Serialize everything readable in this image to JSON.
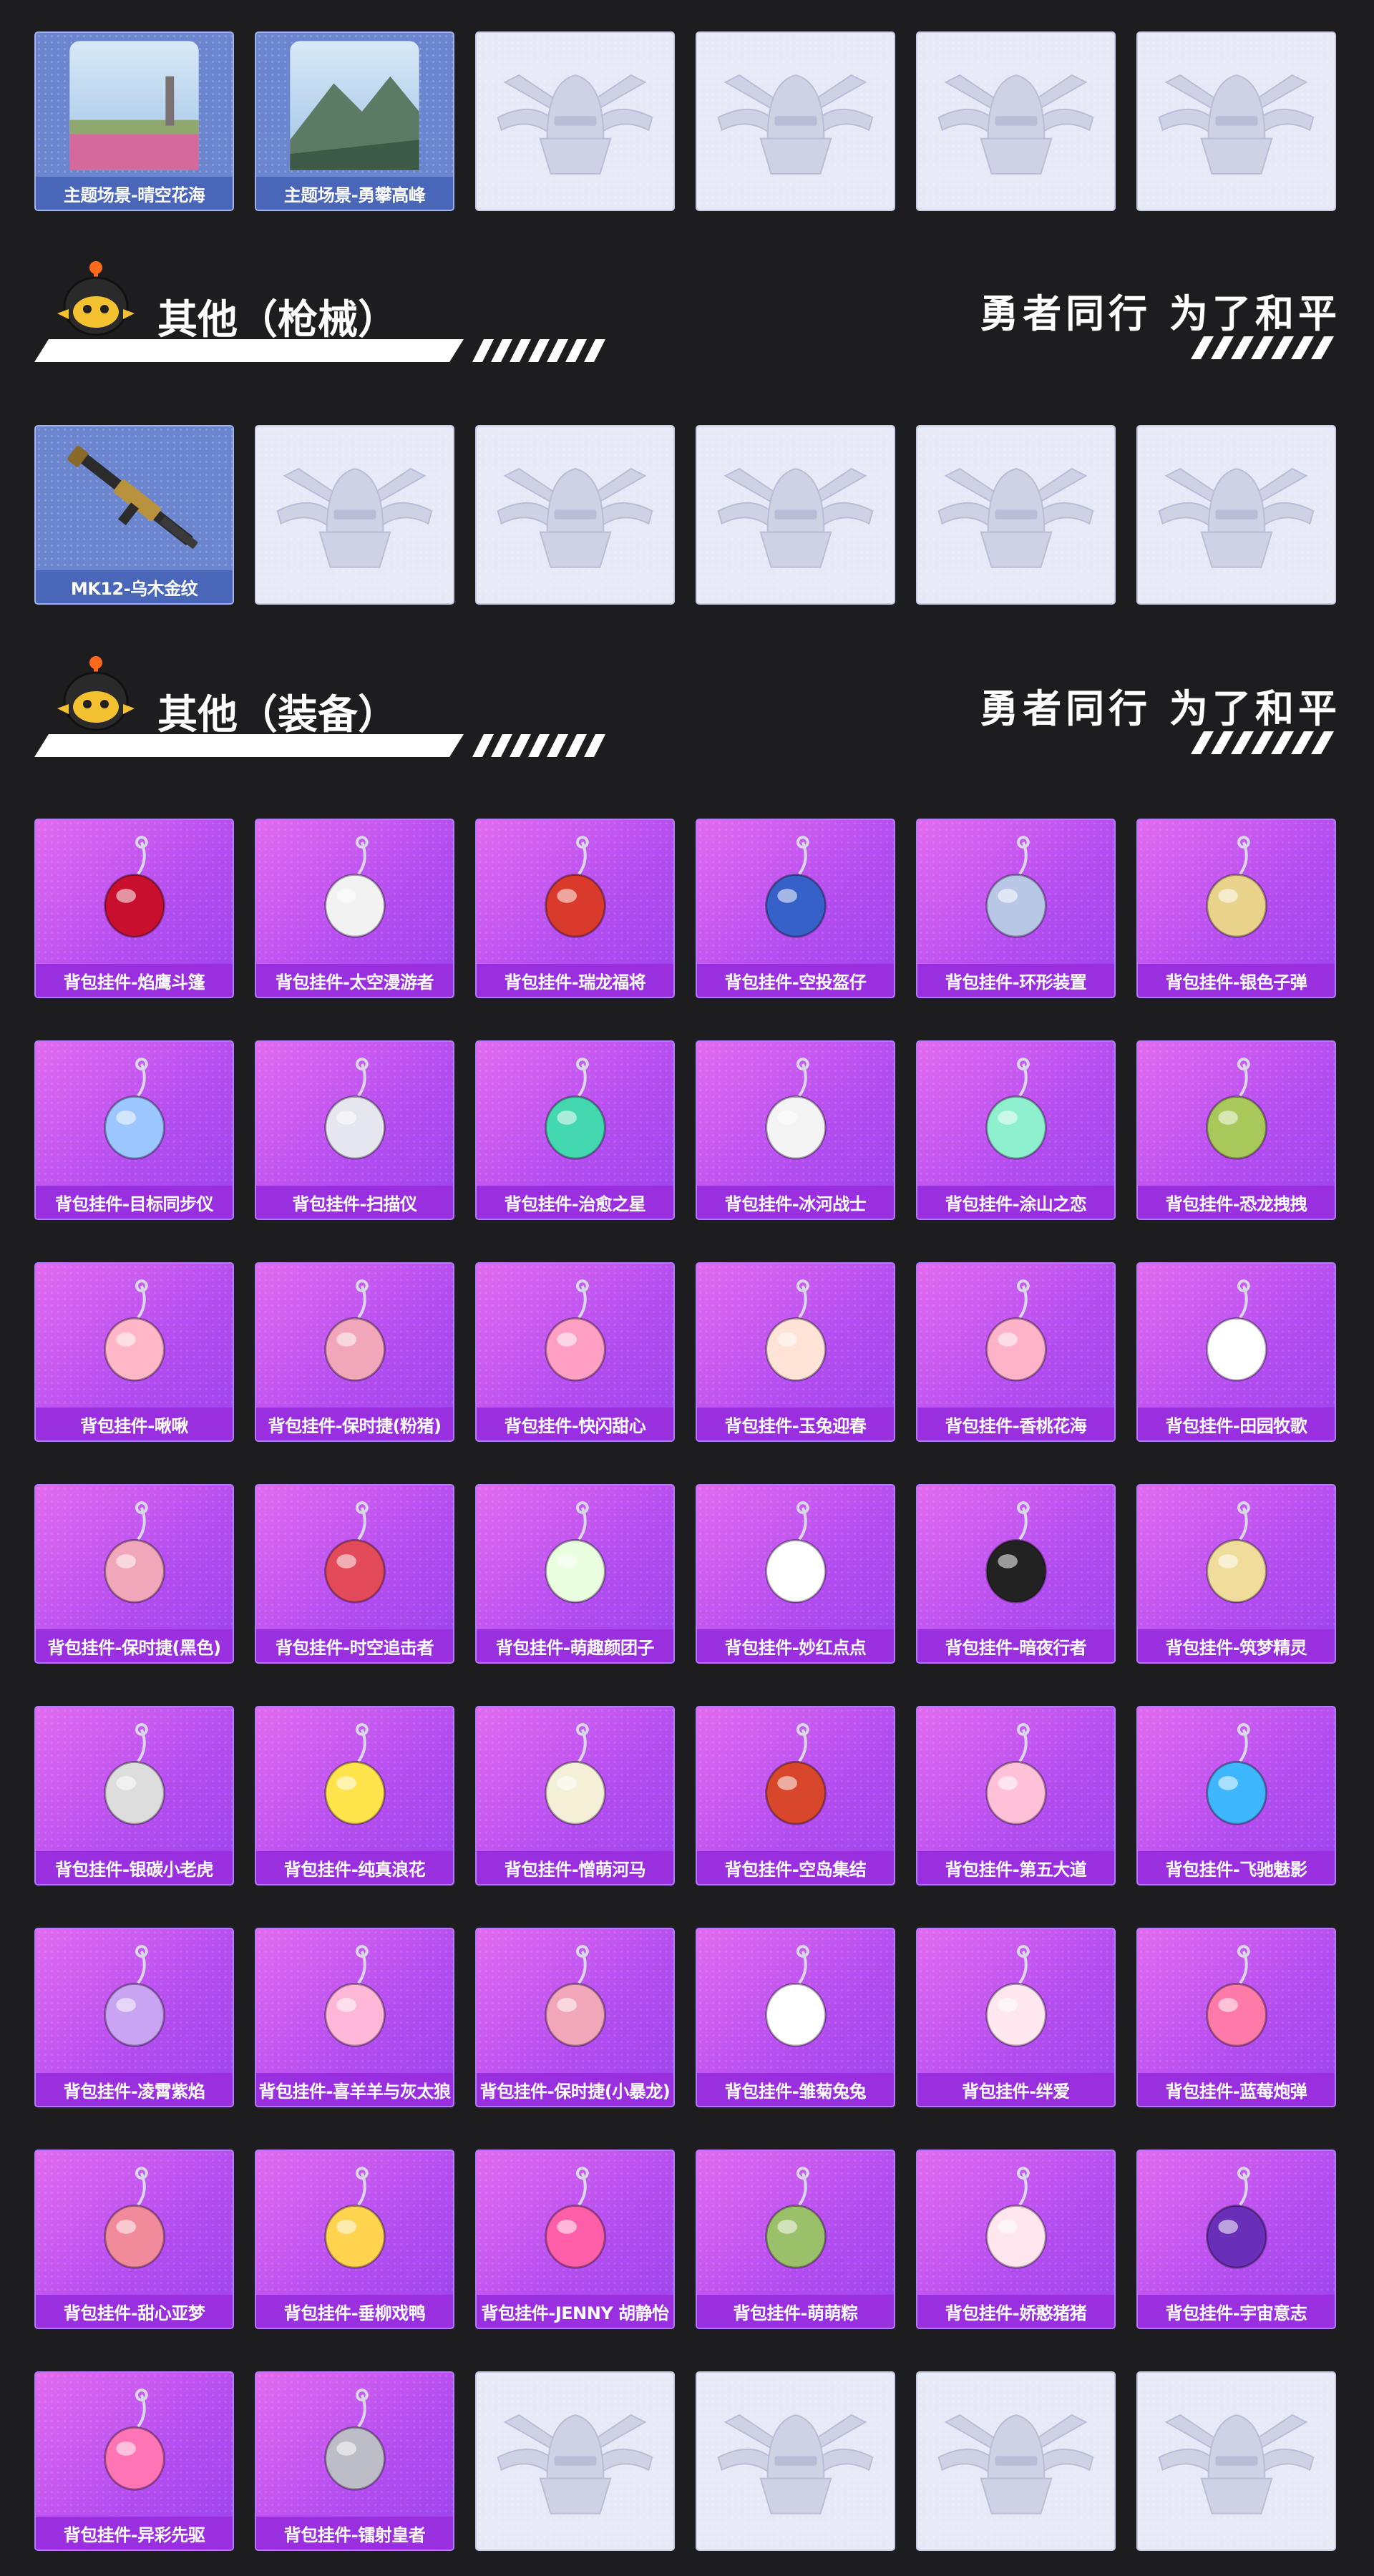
{
  "top_row": {
    "items": [
      {
        "label": "主题场景-晴空花海",
        "kind": "scene",
        "icon": "flower-field-scene"
      },
      {
        "label": "主题场景-勇攀高峰",
        "kind": "scene",
        "icon": "mountain-scene"
      },
      {
        "label": "",
        "kind": "empty",
        "icon": "helmet-emblem-icon"
      },
      {
        "label": "",
        "kind": "empty",
        "icon": "helmet-emblem-icon"
      },
      {
        "label": "",
        "kind": "empty",
        "icon": "helmet-emblem-icon"
      },
      {
        "label": "",
        "kind": "empty",
        "icon": "helmet-emblem-icon"
      }
    ]
  },
  "sections": [
    {
      "title": "其他（枪械）",
      "slogan": "勇者同行 为了和平",
      "rows": [
        [
          {
            "label": "MK12-乌木金纹",
            "kind": "gun",
            "icon": "rifle-icon"
          },
          {
            "label": "",
            "kind": "empty",
            "icon": "helmet-emblem-icon"
          },
          {
            "label": "",
            "kind": "empty",
            "icon": "helmet-emblem-icon"
          },
          {
            "label": "",
            "kind": "empty",
            "icon": "helmet-emblem-icon"
          },
          {
            "label": "",
            "kind": "empty",
            "icon": "helmet-emblem-icon"
          },
          {
            "label": "",
            "kind": "empty",
            "icon": "helmet-emblem-icon"
          }
        ]
      ]
    },
    {
      "title": "其他（装备）",
      "slogan": "勇者同行 为了和平",
      "rows": [
        [
          {
            "label": "背包挂件-焰鹰斗篷",
            "kind": "pendant",
            "icon": "knot-charm-icon"
          },
          {
            "label": "背包挂件-太空漫游者",
            "kind": "pendant",
            "icon": "astronaut-charm-icon"
          },
          {
            "label": "背包挂件-瑞龙福将",
            "kind": "pendant",
            "icon": "dragon-charm-icon"
          },
          {
            "label": "背包挂件-空投盔仔",
            "kind": "pendant",
            "icon": "helmet-charm-icon"
          },
          {
            "label": "背包挂件-环形装置",
            "kind": "pendant",
            "icon": "ring-charm-icon"
          },
          {
            "label": "背包挂件-银色子弹",
            "kind": "pendant",
            "icon": "bullet-charm-icon"
          }
        ],
        [
          {
            "label": "背包挂件-目标同步仪",
            "kind": "pendant",
            "icon": "loop-charm-icon"
          },
          {
            "label": "背包挂件-扫描仪",
            "kind": "pendant",
            "icon": "ghost-charm-icon"
          },
          {
            "label": "背包挂件-治愈之星",
            "kind": "pendant",
            "icon": "canister-charm-icon"
          },
          {
            "label": "背包挂件-冰河战士",
            "kind": "pendant",
            "icon": "robot-charm-icon"
          },
          {
            "label": "背包挂件-涂山之恋",
            "kind": "pendant",
            "icon": "fox-charm-icon"
          },
          {
            "label": "背包挂件-恐龙拽拽",
            "kind": "pendant",
            "icon": "dino-egg-charm-icon"
          }
        ],
        [
          {
            "label": "背包挂件-啾啾",
            "kind": "pendant",
            "icon": "chick-charm-icon"
          },
          {
            "label": "背包挂件-保时捷(粉猪)",
            "kind": "pendant",
            "icon": "car-key-charm-icon"
          },
          {
            "label": "背包挂件-快闪甜心",
            "kind": "pendant",
            "icon": "donut-charm-icon"
          },
          {
            "label": "背包挂件-玉兔迎春",
            "kind": "pendant",
            "icon": "rabbit-charm-icon"
          },
          {
            "label": "背包挂件-香桃花海",
            "kind": "pendant",
            "icon": "peach-blossom-charm-icon"
          },
          {
            "label": "背包挂件-田园牧歌",
            "kind": "pendant",
            "icon": "tag-charm-icon"
          }
        ],
        [
          {
            "label": "背包挂件-保时捷(黑色)",
            "kind": "pendant",
            "icon": "car-key-charm-icon"
          },
          {
            "label": "背包挂件-时空追击者",
            "kind": "pendant",
            "icon": "crest-charm-icon"
          },
          {
            "label": "背包挂件-萌趣颜团子",
            "kind": "pendant",
            "icon": "dumpling-charm-icon"
          },
          {
            "label": "背包挂件-妙红点点",
            "kind": "pendant",
            "icon": "daisy-charm-icon"
          },
          {
            "label": "背包挂件-暗夜行者",
            "kind": "pendant",
            "icon": "bird-charm-icon"
          },
          {
            "label": "背包挂件-筑梦精灵",
            "kind": "pendant",
            "icon": "butterfly-charm-icon"
          }
        ],
        [
          {
            "label": "背包挂件-银碳小老虎",
            "kind": "pendant",
            "icon": "tiger-charm-icon"
          },
          {
            "label": "背包挂件-纯真浪花",
            "kind": "pendant",
            "icon": "opener-charm-icon"
          },
          {
            "label": "背包挂件-憎萌河马",
            "kind": "pendant",
            "icon": "feather-charm-icon"
          },
          {
            "label": "背包挂件-空岛集结",
            "kind": "pendant",
            "icon": "pistol-charm-icon"
          },
          {
            "label": "背包挂件-第五大道",
            "kind": "pendant",
            "icon": "heart-charm-icon"
          },
          {
            "label": "背包挂件-飞驰魅影",
            "kind": "pendant",
            "icon": "winged-eye-charm-icon"
          }
        ],
        [
          {
            "label": "背包挂件-凌霄紫焰",
            "kind": "pendant",
            "icon": "flame-charm-icon"
          },
          {
            "label": "背包挂件-喜羊羊与灰太狼",
            "kind": "pendant",
            "icon": "bow-charm-icon"
          },
          {
            "label": "背包挂件-保时捷(小暴龙)",
            "kind": "pendant",
            "icon": "car-key-charm-icon"
          },
          {
            "label": "背包挂件-雏菊兔兔",
            "kind": "pendant",
            "icon": "bunny-charm-icon"
          },
          {
            "label": "背包挂件-绊爱",
            "kind": "pendant",
            "icon": "ribbon-tag-charm-icon"
          },
          {
            "label": "背包挂件-蓝莓炮弹",
            "kind": "pendant",
            "icon": "icecream-charm-icon"
          }
        ],
        [
          {
            "label": "背包挂件-甜心亚梦",
            "kind": "pendant",
            "icon": "paw-charm-icon"
          },
          {
            "label": "背包挂件-垂柳戏鸭",
            "kind": "pendant",
            "icon": "duck-charm-icon"
          },
          {
            "label": "背包挂件-JENNY 胡静怡",
            "kind": "pendant",
            "icon": "wings-charm-icon"
          },
          {
            "label": "背包挂件-萌萌粽",
            "kind": "pendant",
            "icon": "zongzi-charm-icon"
          },
          {
            "label": "背包挂件-娇憨猪猪",
            "kind": "pendant",
            "icon": "pig-charm-icon"
          },
          {
            "label": "背包挂件-宇宙意志",
            "kind": "pendant",
            "icon": "dagger-charm-icon"
          }
        ],
        [
          {
            "label": "背包挂件-异彩先驱",
            "kind": "pendant",
            "icon": "skate-charm-icon"
          },
          {
            "label": "背包挂件-镭射皇者",
            "kind": "pendant",
            "icon": "headphones-charm-icon"
          },
          {
            "label": "",
            "kind": "empty",
            "icon": "helmet-emblem-icon"
          },
          {
            "label": "",
            "kind": "empty",
            "icon": "helmet-emblem-icon"
          },
          {
            "label": "",
            "kind": "empty",
            "icon": "helmet-emblem-icon"
          },
          {
            "label": "",
            "kind": "empty",
            "icon": "helmet-emblem-icon"
          }
        ]
      ]
    }
  ],
  "colors": {
    "background": "#1d1d1f",
    "pendant_gradient_start": "#e26cf0",
    "pendant_gradient_end": "#9a44ee",
    "scene_label": "#4966b8",
    "empty_card": "#e7e9f7"
  }
}
